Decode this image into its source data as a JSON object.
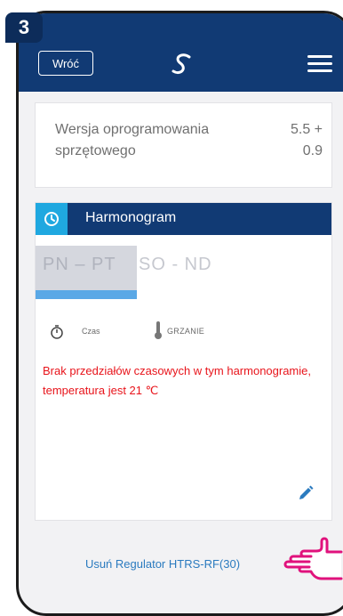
{
  "step": {
    "number": "3"
  },
  "header": {
    "back_label": "Wróć",
    "logo_icon": "salus-logo-icon",
    "menu_icon": "hamburger-menu-icon"
  },
  "version": {
    "label": "Wersja oprogramowania sprzętowego",
    "value": "5.5 +\n0.9"
  },
  "schedule": {
    "title": "Harmonogram",
    "tabs": [
      {
        "label": "PN – PT",
        "selected": true
      },
      {
        "label": "SO - ND",
        "selected": false
      }
    ],
    "legend": {
      "time_label": "Czas",
      "heating_label": "GRZANIE"
    },
    "message": "Brak przedziałów czasowych w tym harmonogramie, temperatura jest 21 ℃"
  },
  "footer": {
    "remove_label": "Usuń Regulator HTRS-RF(30)"
  },
  "colors": {
    "primary": "#113a74",
    "accent": "#1fa8e0",
    "warning": "#e8141b",
    "link": "#2b7bbf",
    "pointer": "#e0127c"
  }
}
